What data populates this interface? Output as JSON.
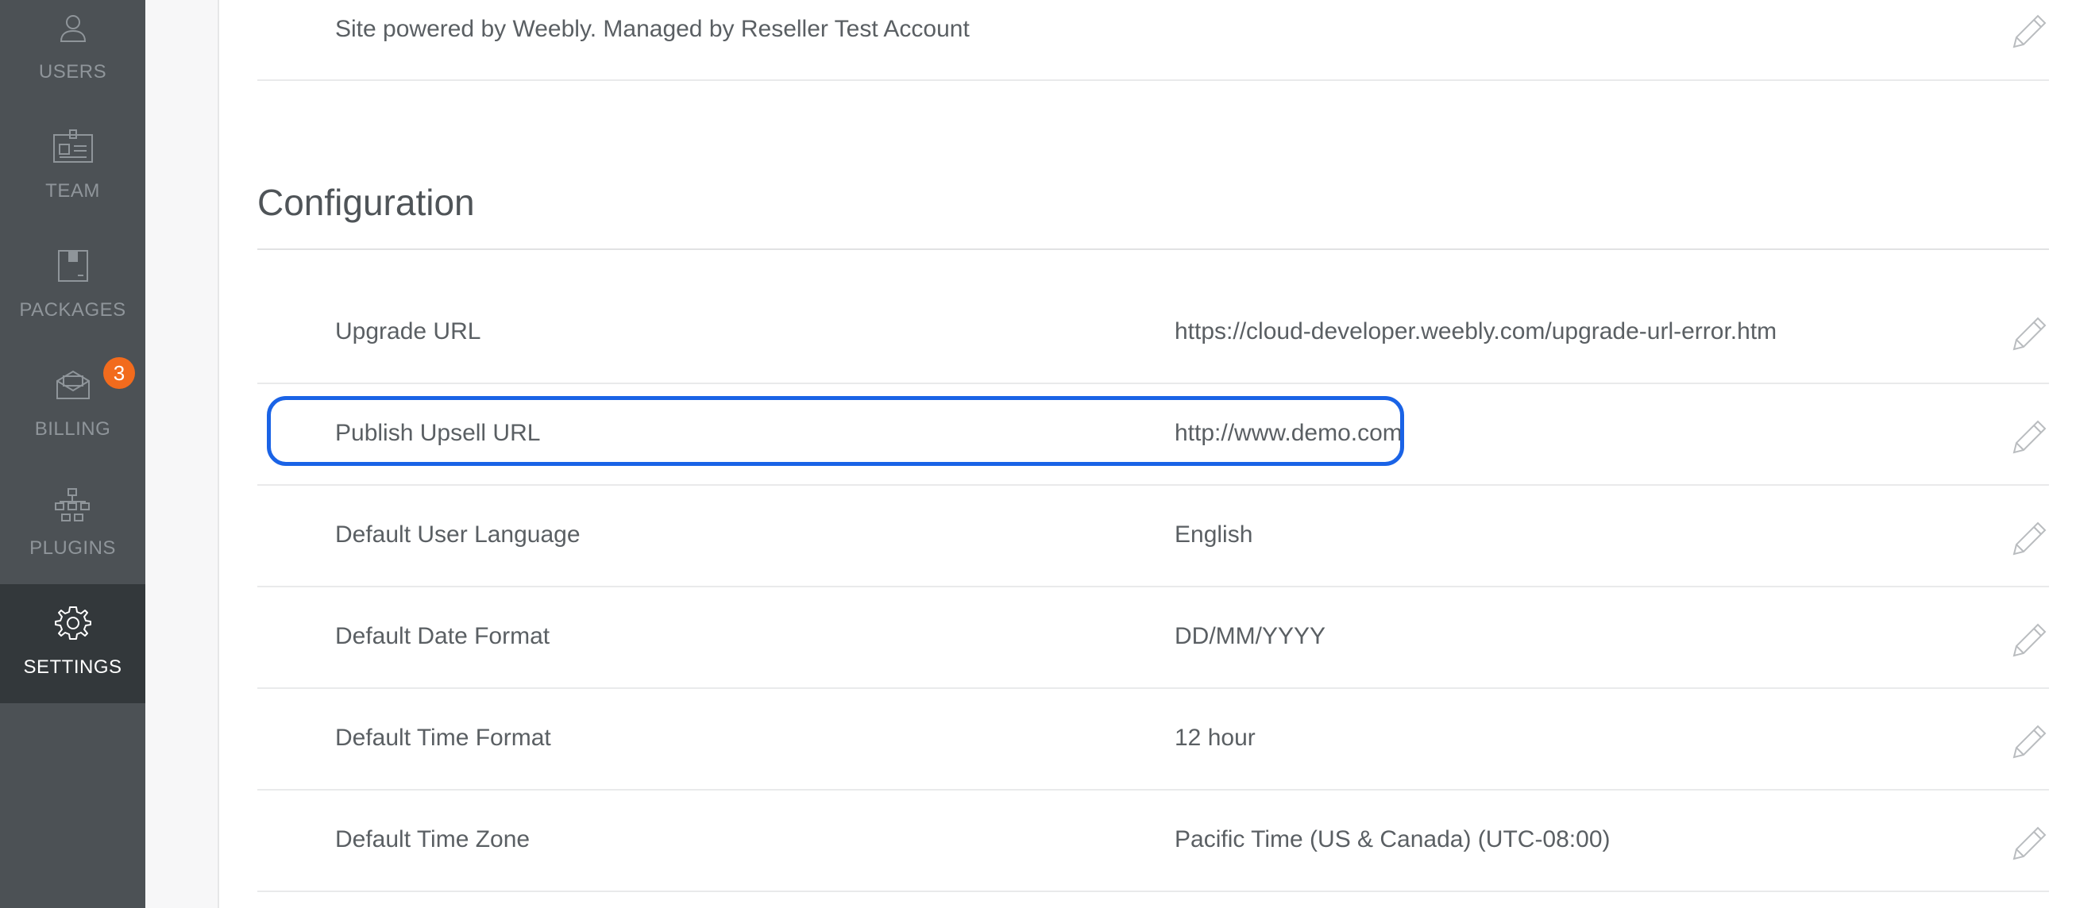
{
  "sidebar": {
    "items": [
      {
        "label": "USERS",
        "icon": "user-icon"
      },
      {
        "label": "TEAM",
        "icon": "id-card-icon"
      },
      {
        "label": "PACKAGES",
        "icon": "package-icon"
      },
      {
        "label": "BILLING",
        "icon": "billing-envelope-icon",
        "badge": "3"
      },
      {
        "label": "PLUGINS",
        "icon": "plugins-icon"
      },
      {
        "label": "SETTINGS",
        "icon": "gear-icon",
        "active": true
      }
    ]
  },
  "footer_row": {
    "label": "Site powered by Weebly. Managed by Reseller Test Account"
  },
  "configuration": {
    "title": "Configuration",
    "rows": [
      {
        "label": "Upgrade URL",
        "value": "https://cloud-developer.weebly.com/upgrade-url-error.htm"
      },
      {
        "label": "Publish Upsell URL",
        "value": "http://www.demo.com",
        "highlighted": true
      },
      {
        "label": "Default User Language",
        "value": "English"
      },
      {
        "label": "Default Date Format",
        "value": "DD/MM/YYYY"
      },
      {
        "label": "Default Time Format",
        "value": "12 hour"
      },
      {
        "label": "Default Time Zone",
        "value": "Pacific Time (US & Canada) (UTC-08:00)"
      }
    ]
  },
  "colors": {
    "sidebar_bg": "#4c5155",
    "sidebar_active_bg": "#33383b",
    "badge": "#f26b1d",
    "highlight": "#1a63e6"
  }
}
